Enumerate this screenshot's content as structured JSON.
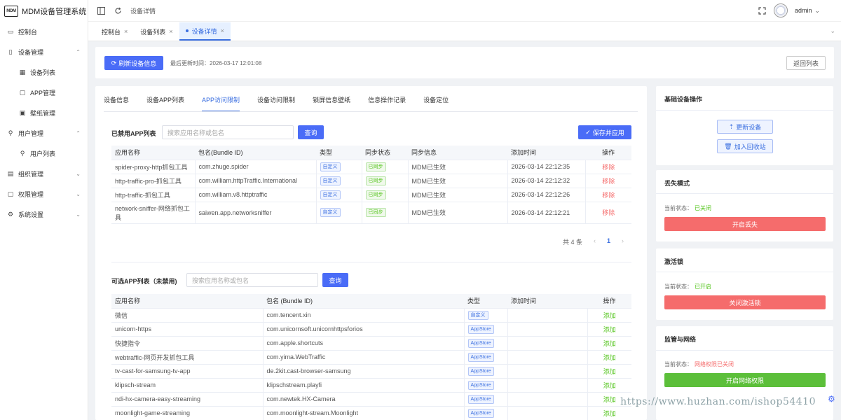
{
  "app": {
    "logo_text": "MDM",
    "title": "MDM设备管理系统"
  },
  "sidebar": {
    "items": [
      {
        "label": "控制台",
        "icon": "monitor-icon",
        "glyph": "▭"
      },
      {
        "label": "设备管理",
        "icon": "tablet-icon",
        "glyph": "▯",
        "arrow": "⌃"
      },
      {
        "label": "设备列表",
        "icon": "grid-icon",
        "glyph": "▦",
        "sub": true
      },
      {
        "label": "APP管理",
        "icon": "box-icon",
        "glyph": "▢",
        "sub": true
      },
      {
        "label": "壁纸管理",
        "icon": "image-icon",
        "glyph": "▣",
        "sub": true
      },
      {
        "label": "用户管理",
        "icon": "user-icon",
        "glyph": "⚲",
        "arrow": "⌃"
      },
      {
        "label": "用户列表",
        "icon": "user-icon",
        "glyph": "⚲",
        "sub": true
      },
      {
        "label": "组织管理",
        "icon": "org-icon",
        "glyph": "▤",
        "arrow": "⌄"
      },
      {
        "label": "权限管理",
        "icon": "lock-icon",
        "glyph": "▢",
        "arrow": "⌄"
      },
      {
        "label": "系统设置",
        "icon": "gear-icon",
        "glyph": "⚙",
        "arrow": "⌄"
      }
    ]
  },
  "topbar": {
    "breadcrumb": "设备详情",
    "user": "admin",
    "user_arrow": "⌄"
  },
  "tabs": [
    {
      "label": "控制台",
      "close": "×"
    },
    {
      "label": "设备列表",
      "close": "×"
    },
    {
      "label": "设备详情",
      "close": "×",
      "active": true
    }
  ],
  "tabs_more": "⌄",
  "toolbar": {
    "refresh_label": "刷新设备信息",
    "last_update": "最后更新时间：2026-03-17 12:01:08",
    "back_label": "返回列表"
  },
  "subtabs": [
    "设备信息",
    "设备APP列表",
    "APP访问限制",
    "设备访问限制",
    "锁屏信息壁纸",
    "信息操作记录",
    "设备定位"
  ],
  "banned": {
    "title": "已禁用APP列表",
    "placeholder": "搜索应用名称或包名",
    "search_label": "查询",
    "save_label": "保存并应用",
    "columns": [
      "应用名称",
      "包名(Bundle ID)",
      "类型",
      "同步状态",
      "同步信息",
      "添加时间",
      "操作"
    ],
    "rows": [
      {
        "name": "spider-proxy-http抓包工具",
        "bundle": "com.zhuge.spider",
        "type": "自定义",
        "status": "已同步",
        "info": "MDM已生效",
        "time": "2026-03-14 22:12:35",
        "action": "移除"
      },
      {
        "name": "http-traffic-pro-抓包工具",
        "bundle": "com.william.httpTraffic.International",
        "type": "自定义",
        "status": "已同步",
        "info": "MDM已生效",
        "time": "2026-03-14 22:12:32",
        "action": "移除"
      },
      {
        "name": "http-traffic-抓包工具",
        "bundle": "com.william.v8.httptraffic",
        "type": "自定义",
        "status": "已同步",
        "info": "MDM已生效",
        "time": "2026-03-14 22:12:26",
        "action": "移除"
      },
      {
        "name": "network-sniffer-网络抓包工具",
        "bundle": "saiwen.app.networksniffer",
        "type": "自定义",
        "status": "已同步",
        "info": "MDM已生效",
        "time": "2026-03-14 22:12:21",
        "action": "移除"
      }
    ],
    "pagination": {
      "total": "共 4 条",
      "prev": "‹",
      "page": "1",
      "next": "›"
    }
  },
  "available": {
    "title": "可选APP列表（未禁用)",
    "placeholder": "搜索应用名称或包名",
    "search_label": "查询",
    "columns": [
      "应用名称",
      "包名 (Bundle ID)",
      "类型",
      "添加时间",
      "操作"
    ],
    "rows": [
      {
        "name": "微信",
        "bundle": "com.tencent.xin",
        "type": "自定义",
        "time": "",
        "action": "添加"
      },
      {
        "name": "unicorn-https",
        "bundle": "com.unicornsoft.unicornhttpsforios",
        "type": "AppStore",
        "time": "",
        "action": "添加"
      },
      {
        "name": "快捷指令",
        "bundle": "com.apple.shortcuts",
        "type": "AppStore",
        "time": "",
        "action": "添加"
      },
      {
        "name": "webtraffic-网页开发抓包工具",
        "bundle": "com.yima.WebTraffic",
        "type": "AppStore",
        "time": "",
        "action": "添加"
      },
      {
        "name": "tv-cast-for-samsung-tv-app",
        "bundle": "de.2kit.cast-browser-samsung",
        "type": "AppStore",
        "time": "",
        "action": "添加"
      },
      {
        "name": "klipsch-stream",
        "bundle": "klipschstream.playfi",
        "type": "AppStore",
        "time": "",
        "action": "添加"
      },
      {
        "name": "ndi-hx-camera-easy-streaming",
        "bundle": "com.newtek.HX-Camera",
        "type": "AppStore",
        "time": "",
        "action": "添加"
      },
      {
        "name": "moonlight-game-streaming",
        "bundle": "com.moonlight-stream.Moonlight",
        "type": "AppStore",
        "time": "",
        "action": "添加"
      }
    ]
  },
  "side": {
    "basic": {
      "title": "基础设备操作",
      "update_label": "更新设备",
      "recycle_label": "加入回收站"
    },
    "lost": {
      "title": "丢失模式",
      "status_label": "当前状态：",
      "status": "已关闭",
      "button": "开启丢失"
    },
    "activation": {
      "title": "激活锁",
      "status_label": "当前状态：",
      "status": "已开启",
      "button": "关闭激活锁"
    },
    "network": {
      "title": "监管与网络",
      "status_label": "当前状态：",
      "status": "网络权限已关闭",
      "button": "开启网络权限"
    }
  },
  "watermark": "https://www.huzhan.com/ishop54410",
  "colors": {
    "primary": "#4a6cf7",
    "danger": "#f56c6c",
    "success": "#52c41a",
    "button_green": "#5cbf3a"
  }
}
